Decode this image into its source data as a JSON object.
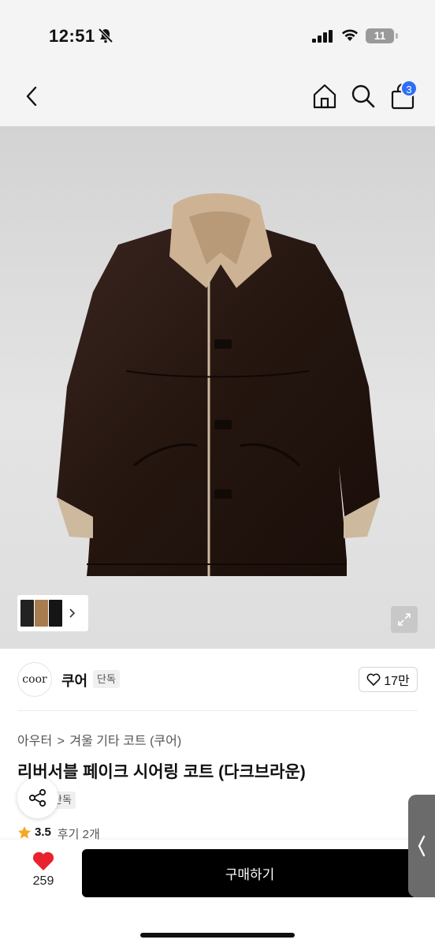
{
  "status_bar": {
    "time": "12:51",
    "battery": "11"
  },
  "header": {
    "cart_count": "3"
  },
  "gallery": {
    "thumbnail_count": 3
  },
  "brand": {
    "logo_text": "coor",
    "name": "쿠어",
    "tag": "단독",
    "likes": "17만"
  },
  "product": {
    "breadcrumb": [
      "아우터",
      "겨울 기타 코트 (쿠어)"
    ],
    "breadcrumb_separator": ">",
    "title": "리버서블 페이크 시어링 코트 (다크브라운)",
    "exclusive_tag": "단독",
    "rating": "3.5",
    "reviews": "후기 2개"
  },
  "bottom_bar": {
    "wishlist_count": "259",
    "buy_label": "구매하기"
  },
  "colors": {
    "accent_blue": "#2f6ef6",
    "heart_red": "#e8222e",
    "buy_black": "#000000"
  }
}
